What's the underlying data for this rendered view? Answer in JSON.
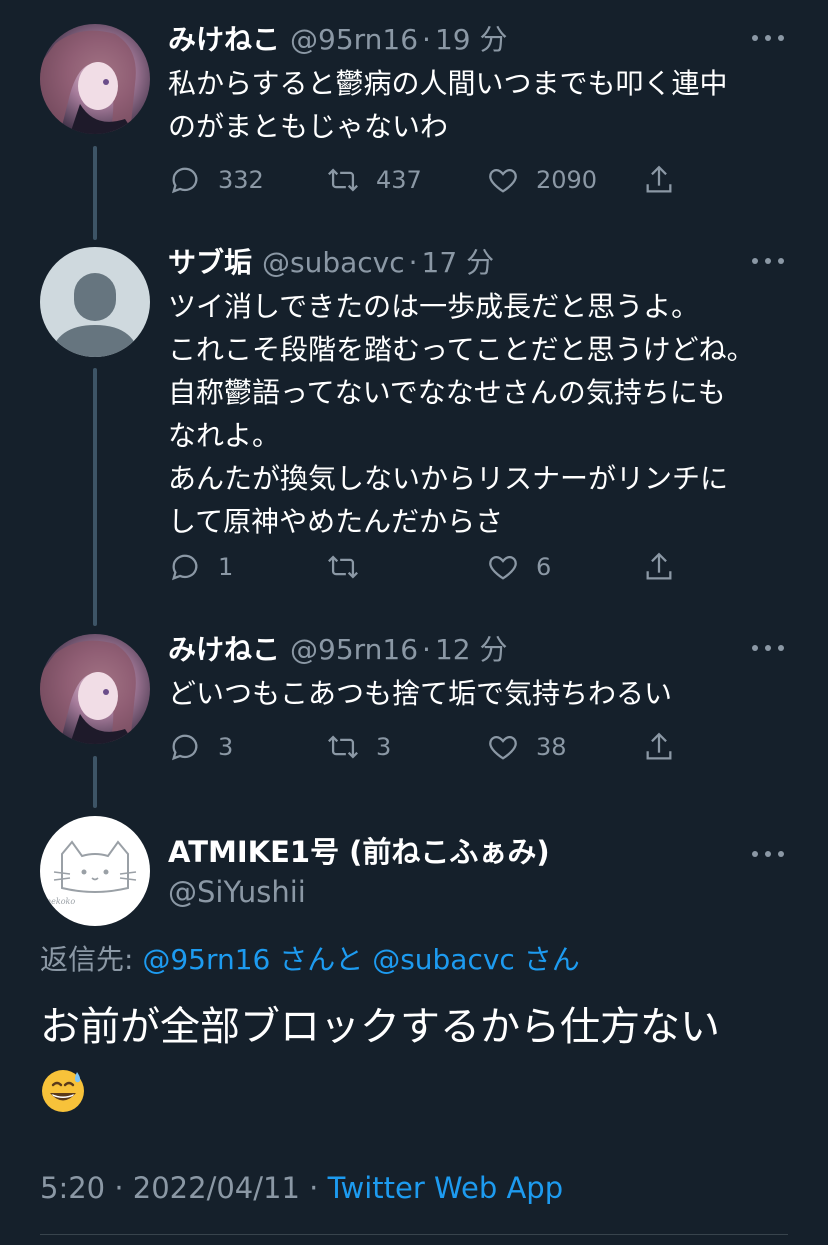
{
  "tweets": [
    {
      "name": "みけねこ",
      "handle": "@95rn16",
      "time": "19 分",
      "lines": [
        "私からすると鬱病の人間いつまでも叩く連中",
        "のがまともじゃないわ"
      ],
      "replies": "332",
      "retweets": "437",
      "likes": "2090"
    },
    {
      "name": "サブ垢",
      "handle": "@subacvc",
      "time": "17 分",
      "lines": [
        "ツイ消しできたのは一歩成長だと思うよ。",
        "これこそ段階を踏むってことだと思うけどね。",
        "自称鬱語ってないでななせさんの気持ちにも",
        "なれよ。",
        "あんたが換気しないからリスナーがリンチに",
        "して原神やめたんだからさ"
      ],
      "replies": "1",
      "retweets": "",
      "likes": "6"
    },
    {
      "name": "みけねこ",
      "handle": "@95rn16",
      "time": "12 分",
      "lines": [
        "どいつもこあつも捨て垢で気持ちわるい"
      ],
      "replies": "3",
      "retweets": "3",
      "likes": "38"
    }
  ],
  "main": {
    "name": "ATMIKE1号 (前ねこふぁみ)",
    "handle": "@SiYushii",
    "avatar_text": "nekoko",
    "reply_prefix": "返信先: ",
    "reply_user1": "@95rn16 さん",
    "reply_and": "と",
    "reply_user2": "@subacvc さん",
    "text": "お前が全部ブロックするから仕方ない",
    "emoji": "grinning-sweat-emoji",
    "time": "5:20",
    "date": "2022/04/11",
    "source": "Twitter Web App",
    "sep": " · "
  },
  "icons": {
    "reply": "reply-bubble-icon",
    "retweet": "retweet-arrows-icon",
    "like": "heart-icon",
    "share": "share-upload-icon",
    "more": "more-dots-icon"
  },
  "colors": {
    "background": "#15202b",
    "secondary_text": "#8b98a5",
    "link": "#1d9bf0",
    "thread_line": "#3d5466"
  }
}
